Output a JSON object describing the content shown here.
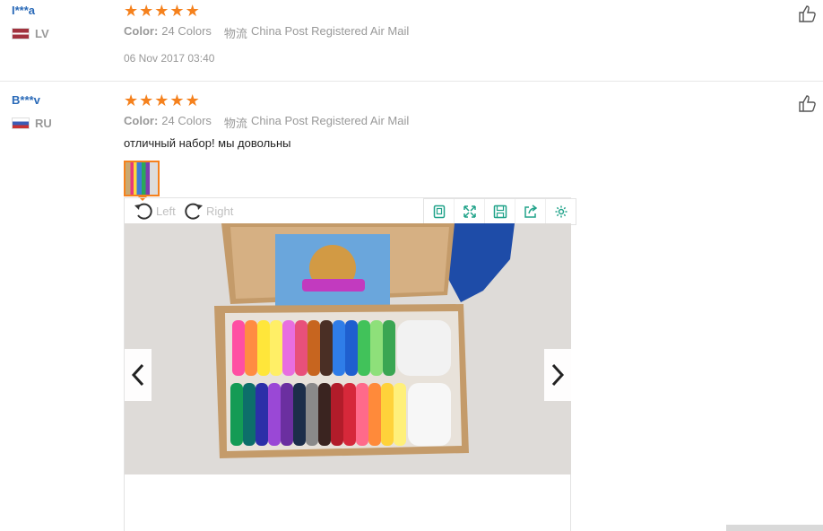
{
  "reviews": [
    {
      "user": "I***a",
      "country": "LV",
      "rating": 5,
      "color_label": "Color:",
      "color_value": "24 Colors",
      "shipping_label": "物流",
      "shipping_value": "China Post Registered Air Mail",
      "date": "06 Nov 2017 03:40"
    },
    {
      "user": "B***v",
      "country": "RU",
      "rating": 5,
      "color_label": "Color:",
      "color_value": "24 Colors",
      "shipping_label": "物流",
      "shipping_value": "China Post Registered Air Mail",
      "text": "отличный набор! мы довольны"
    }
  ],
  "viewer": {
    "rotate_left": "Left",
    "rotate_right": "Right",
    "tools": [
      "fit-screen-icon",
      "fullscreen-icon",
      "save-icon",
      "share-icon",
      "settings-icon"
    ]
  },
  "colors": {
    "star": "#f5811d",
    "link": "#2a6ab8",
    "accent": "#21a38a"
  }
}
